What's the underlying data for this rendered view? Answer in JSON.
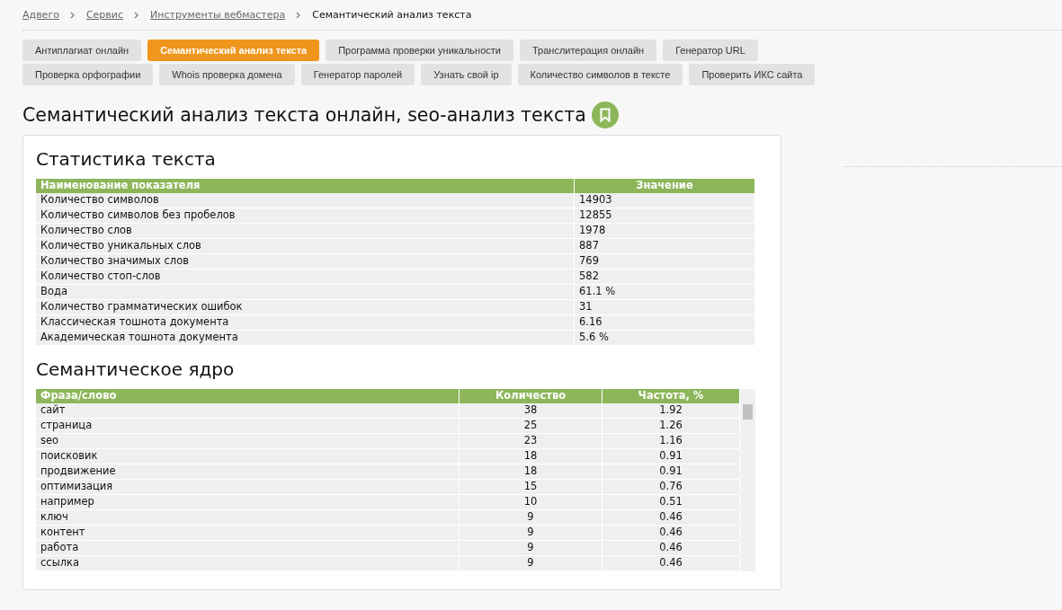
{
  "breadcrumbs": [
    {
      "label": "Адвего",
      "link": true
    },
    {
      "label": "Сервис",
      "link": true
    },
    {
      "label": "Инструменты вебмастера",
      "link": true
    },
    {
      "label": "Семантический анализ текста",
      "link": false
    }
  ],
  "tools": [
    {
      "label": "Антиплагиат онлайн",
      "selected": false
    },
    {
      "label": "Семантический анализ текста",
      "selected": true
    },
    {
      "label": "Программа проверки уникальности",
      "selected": false
    },
    {
      "label": "Транслитерация онлайн",
      "selected": false
    },
    {
      "label": "Генератор URL",
      "selected": false
    },
    {
      "label": "Проверка орфографии",
      "selected": false
    },
    {
      "label": "Whois проверка домена",
      "selected": false
    },
    {
      "label": "Генератор паролей",
      "selected": false
    },
    {
      "label": "Узнать свой ip",
      "selected": false
    },
    {
      "label": "Количество символов в тексте",
      "selected": false
    },
    {
      "label": "Проверить ИКС сайта",
      "selected": false
    }
  ],
  "page_title": "Семантический анализ текста онлайн, seo-анализ текста",
  "stats": {
    "title": "Статистика текста",
    "columns": [
      "Наименование показателя",
      "Значение"
    ],
    "rows": [
      [
        "Количество символов",
        "14903"
      ],
      [
        "Количество символов без пробелов",
        "12855"
      ],
      [
        "Количество слов",
        "1978"
      ],
      [
        "Количество уникальных слов",
        "887"
      ],
      [
        "Количество значимых слов",
        "769"
      ],
      [
        "Количество стоп-слов",
        "582"
      ],
      [
        "Вода",
        "61.1 %"
      ],
      [
        "Количество грамматических ошибок",
        "31"
      ],
      [
        "Классическая тошнота документа",
        "6.16"
      ],
      [
        "Академическая тошнота документа",
        "5.6 %"
      ]
    ]
  },
  "core": {
    "title": "Семантическое ядро",
    "columns": [
      "Фраза/слово",
      "Количество",
      "Частота, %"
    ],
    "rows": [
      [
        "сайт",
        "38",
        "1.92"
      ],
      [
        "страница",
        "25",
        "1.26"
      ],
      [
        "seo",
        "23",
        "1.16"
      ],
      [
        "поисковик",
        "18",
        "0.91"
      ],
      [
        "продвижение",
        "18",
        "0.91"
      ],
      [
        "оптимизация",
        "15",
        "0.76"
      ],
      [
        "например",
        "10",
        "0.51"
      ],
      [
        "ключ",
        "9",
        "0.46"
      ],
      [
        "контент",
        "9",
        "0.46"
      ],
      [
        "работа",
        "9",
        "0.46"
      ],
      [
        "ссылка",
        "9",
        "0.46"
      ]
    ]
  }
}
